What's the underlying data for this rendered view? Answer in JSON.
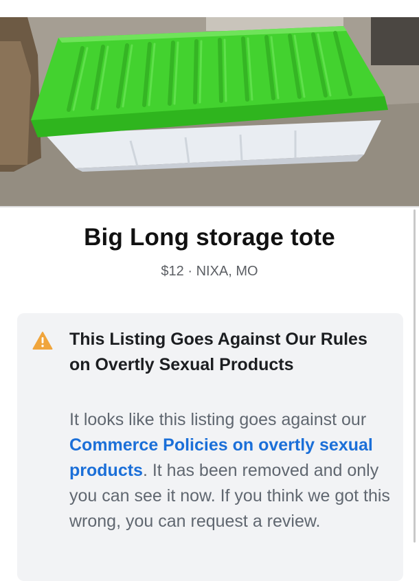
{
  "listing": {
    "title": "Big Long storage tote",
    "price": "$12",
    "separator": " · ",
    "location": "NIXA, MO"
  },
  "notice": {
    "icon": "warning-triangle-icon",
    "title": "This Listing Goes Against Our Rules on Overtly Sexual Products",
    "body_before": "It looks like this listing goes against our ",
    "link_text": "Commerce Policies on overtly sexual products",
    "body_after": ". It has been removed and only you can see it now. If you think we got this wrong, you can request a review."
  },
  "colors": {
    "lid_green": "#3dd12a",
    "link_blue": "#1b6fd8",
    "warning_orange": "#f0a53c"
  }
}
